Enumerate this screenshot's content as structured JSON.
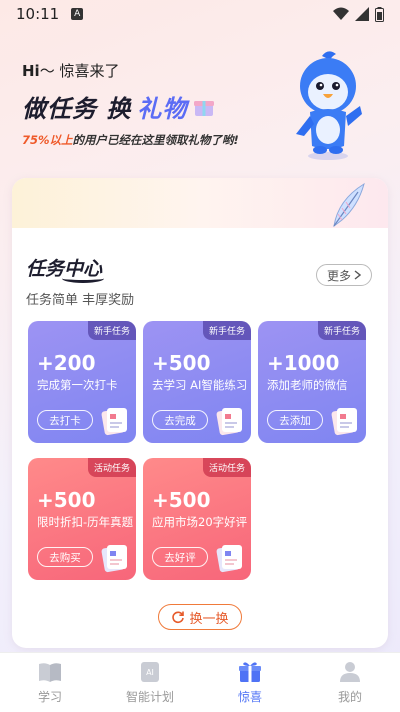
{
  "status_bar": {
    "time": "10:11",
    "a_label": "A"
  },
  "hero": {
    "hi_prefix": "Hi",
    "hi_rest": "～ 惊喜来了",
    "title_part1": "做任务 换",
    "title_part2": "礼物",
    "subtitle_pct": "75%以上",
    "subtitle_rest": "的用户已经在这里领取礼物了哟!"
  },
  "task_center": {
    "title": "任务中心",
    "subtitle": "任务简单 丰厚奖励",
    "more_label": "更多"
  },
  "tasks": [
    {
      "tag": "新手任务",
      "amount": "+200",
      "desc": "完成第一次打卡",
      "button": "去打卡"
    },
    {
      "tag": "新手任务",
      "amount": "+500",
      "desc": "去学习 AI智能练习",
      "button": "去完成"
    },
    {
      "tag": "新手任务",
      "amount": "+1000",
      "desc": "添加老师的微信",
      "button": "去添加"
    },
    {
      "tag": "活动任务",
      "amount": "+500",
      "desc": "限时折扣-历年真题",
      "button": "去购买"
    },
    {
      "tag": "活动任务",
      "amount": "+500",
      "desc": "应用市场20字好评",
      "button": "去好评"
    }
  ],
  "refresh_label": "换一换",
  "tabbar": [
    {
      "label": "学习",
      "icon": "book-icon"
    },
    {
      "label": "智能计划",
      "icon": "ai-icon"
    },
    {
      "label": "惊喜",
      "icon": "gift-icon"
    },
    {
      "label": "我的",
      "icon": "user-icon"
    }
  ],
  "colors": {
    "accent": "#4f73f5",
    "orange": "#ef5a2a",
    "task_blue": "#8a8cf2",
    "task_red": "#f97584"
  }
}
